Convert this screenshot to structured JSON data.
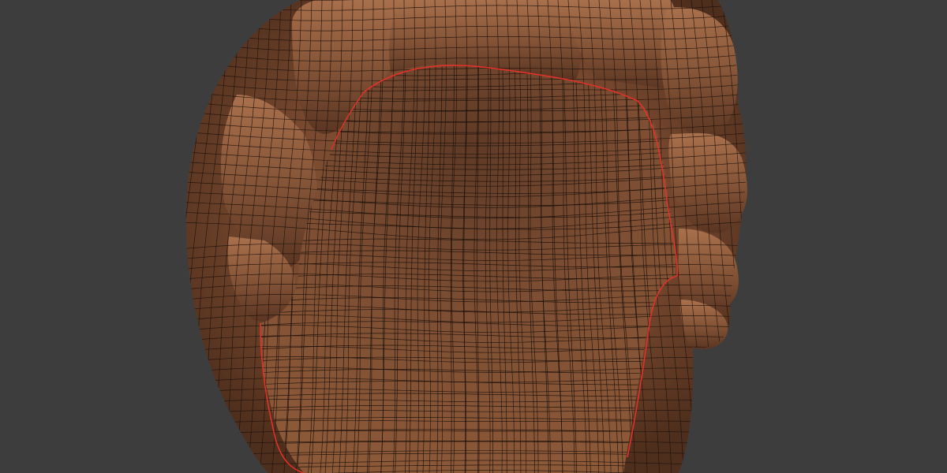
{
  "viewport": {
    "background_color": "#3d3d3d",
    "object": {
      "kind": "sculpt-mesh",
      "shading": "matcap-clay",
      "base_color": "#7a4a30",
      "wireframe_color": "#1a0f0a",
      "seam_color": "#e0322a",
      "wireframe_overlay": true,
      "seam_visible": true
    }
  }
}
